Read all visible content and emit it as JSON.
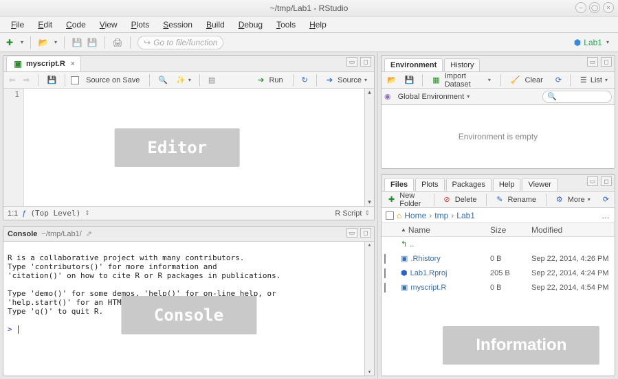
{
  "window": {
    "title": "~/tmp/Lab1 - RStudio"
  },
  "menus": [
    "File",
    "Edit",
    "Code",
    "View",
    "Plots",
    "Session",
    "Build",
    "Debug",
    "Tools",
    "Help"
  ],
  "goto_placeholder": "Go to file/function",
  "project": {
    "name": "Lab1"
  },
  "editor": {
    "tab": "myscript.R",
    "source_on_save": "Source on Save",
    "run": "Run",
    "source_btn": "Source",
    "line_num": "1",
    "status_pos": "1:1",
    "scope": "(Top Level)",
    "lang": "R Script",
    "overlay": "Editor"
  },
  "console": {
    "title": "Console",
    "path": "~/tmp/Lab1/",
    "text": "R is a collaborative project with many contributors.\nType 'contributors()' for more information and\n'citation()' on how to cite R or R packages in publications.\n\nType 'demo()' for some demos, 'help()' for on-line help, or\n'help.start()' for an HTML browser interface to help.\nType 'q()' to quit R.\n",
    "prompt": ">",
    "overlay": "Console"
  },
  "env": {
    "tabs": [
      "Environment",
      "History"
    ],
    "import": "Import Dataset",
    "clear": "Clear",
    "listmode": "List",
    "scope": "Global Environment",
    "empty": "Environment is empty"
  },
  "files": {
    "tabs": [
      "Files",
      "Plots",
      "Packages",
      "Help",
      "Viewer"
    ],
    "newfolder": "New Folder",
    "delete": "Delete",
    "rename": "Rename",
    "more": "More",
    "crumbs": [
      "Home",
      "tmp",
      "Lab1"
    ],
    "hdr_name": "Name",
    "hdr_size": "Size",
    "hdr_mod": "Modified",
    "up": "..",
    "rows": [
      {
        "name": ".Rhistory",
        "size": "0 B",
        "mod": "Sep 22, 2014, 4:26 PM"
      },
      {
        "name": "Lab1.Rproj",
        "size": "205 B",
        "mod": "Sep 22, 2014, 4:24 PM"
      },
      {
        "name": "myscript.R",
        "size": "0 B",
        "mod": "Sep 22, 2014, 4:54 PM"
      }
    ],
    "overlay": "Information"
  }
}
